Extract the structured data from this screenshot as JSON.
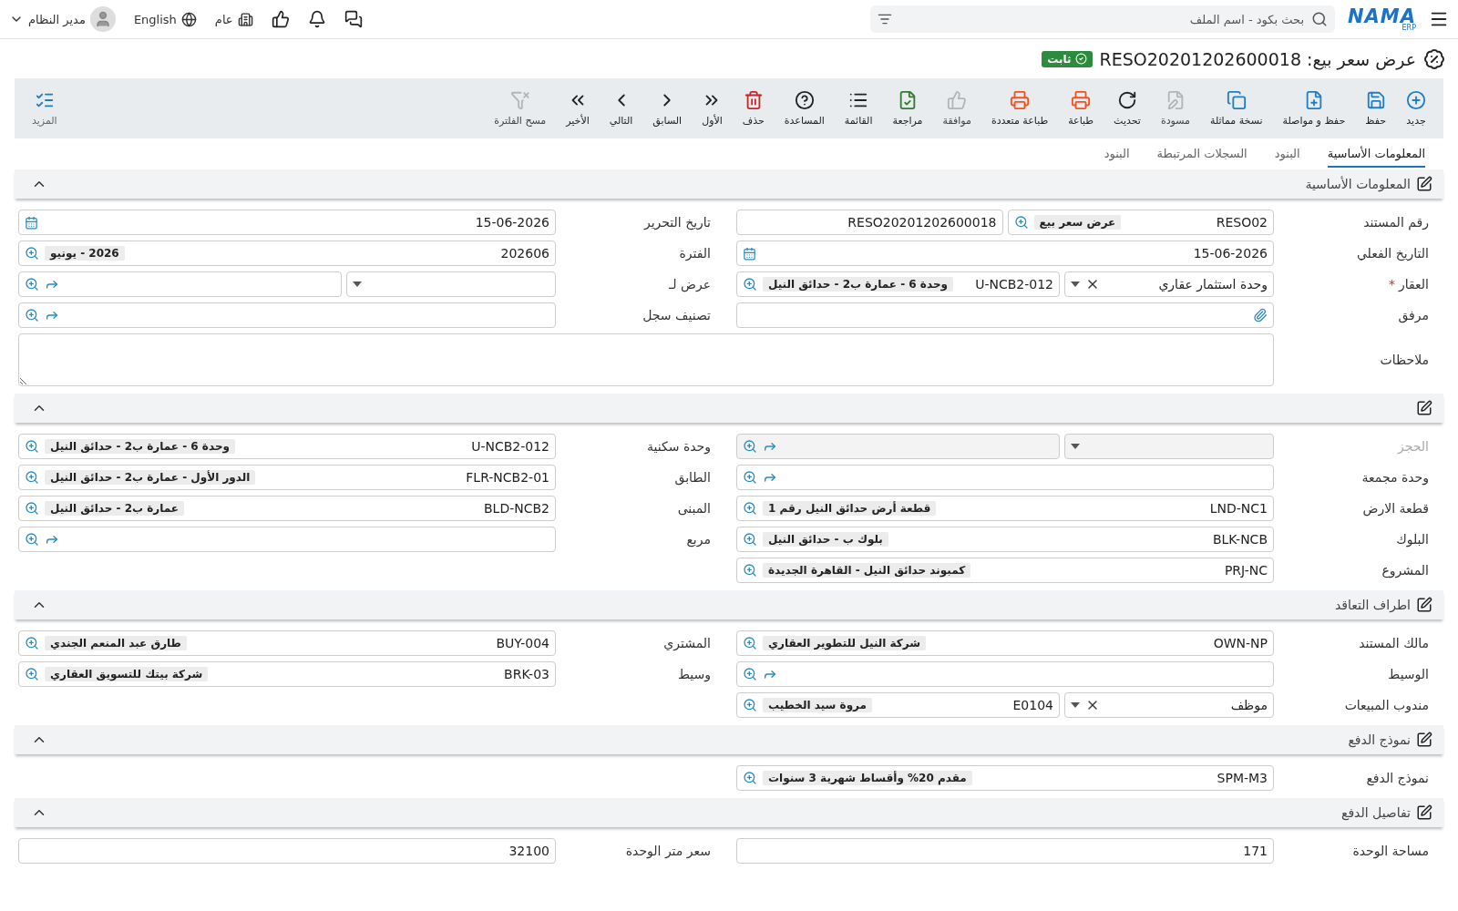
{
  "top_bar": {
    "logo": "NAMA",
    "logo_sub": "ERP",
    "search": {
      "placeholder": "بحث بكود - اسم الملف"
    },
    "user": "مدير النظام",
    "language": "English",
    "branch": "عام"
  },
  "title": {
    "text": "عرض سعر بيع: RESO20201202600018",
    "status": "ثابت"
  },
  "toolbar": {
    "buttons": [
      {
        "label": "جديد",
        "color": "#1f7fc4",
        "disabled": false
      },
      {
        "label": "حفظ",
        "color": "#1f7fc4",
        "disabled": false
      },
      {
        "label": "حفظ و مواصلة",
        "color": "#1f7fc4",
        "disabled": false
      },
      {
        "label": "نسخة مماثلة",
        "color": "#1f7fc4",
        "disabled": false
      },
      {
        "label": "مسودة",
        "color": "#b4b4b4",
        "disabled": true
      },
      {
        "label": "تحديث",
        "color": "#222222",
        "disabled": false
      },
      {
        "label": "طباعة",
        "color": "#f4511e",
        "disabled": false
      },
      {
        "label": "طباعة متعددة",
        "color": "#f4511e",
        "disabled": false
      },
      {
        "label": "موافقة",
        "color": "#b4b4b4",
        "disabled": true
      },
      {
        "label": "مراجعة",
        "color": "#2e7d32",
        "disabled": false
      },
      {
        "label": "القائمة",
        "color": "#222222",
        "disabled": false
      },
      {
        "label": "المساعدة",
        "color": "#222222",
        "disabled": false
      },
      {
        "label": "حذف",
        "color": "#c62828",
        "disabled": false
      },
      {
        "label": "الأول",
        "color": "#222222",
        "disabled": false
      },
      {
        "label": "السابق",
        "color": "#222222",
        "disabled": false
      },
      {
        "label": "التالي",
        "color": "#222222",
        "disabled": false
      },
      {
        "label": "الأخير",
        "color": "#222222",
        "disabled": false
      },
      {
        "label": "مسح الفلترة",
        "color": "#b4b4b4",
        "disabled": true
      }
    ],
    "more": {
      "label": "المزيد"
    }
  },
  "tabs": [
    {
      "label": "المعلومات الأساسية",
      "selected": true
    },
    {
      "label": "البنود",
      "selected": false
    },
    {
      "label": "السجلات المرتبطة",
      "selected": false
    },
    {
      "label": "البنود",
      "selected": false
    }
  ],
  "sections": [
    {
      "title": "المعلومات الأساسية",
      "expanded": true,
      "rows": [
        [
          {
            "label": "رقم المستند",
            "parts": [
              {
                "kind": "lookup",
                "value": "RESO02",
                "display": "عرض سعر بيع"
              },
              {
                "kind": "text",
                "value": "RESO20201202600018"
              }
            ]
          },
          {
            "label": "تاريخ التحرير",
            "parts": [
              {
                "kind": "date",
                "value": "15-06-2026"
              }
            ]
          }
        ],
        [
          {
            "label": "التاريخ الفعلي",
            "parts": [
              {
                "kind": "date",
                "value": "15-06-2026"
              }
            ]
          },
          {
            "label": "الفترة",
            "parts": [
              {
                "kind": "lookup",
                "value": "202606",
                "display": "2026 - يونيو"
              }
            ]
          }
        ],
        [
          {
            "label": "العقار",
            "required_mark": "*",
            "parts": [
              {
                "kind": "select",
                "value": "وحدة استثمار عقاري",
                "clearable": true
              },
              {
                "kind": "lookup",
                "value": "U-NCB2-012",
                "display": "وحدة 6 - عمارة ب2 - حدائق النيل"
              }
            ]
          },
          {
            "label": "عرض لـ",
            "parts": [
              {
                "kind": "select"
              },
              {
                "kind": "lookup",
                "link": true
              }
            ]
          }
        ],
        [
          {
            "label": "مرفق",
            "parts": [
              {
                "kind": "attach"
              }
            ]
          },
          {
            "label": "تصنيف سجل",
            "parts": [
              {
                "kind": "lookup",
                "link": true
              }
            ]
          }
        ],
        [
          {
            "label": "ملاحظات",
            "wide": true,
            "parts": [
              {
                "kind": "textarea"
              }
            ]
          }
        ]
      ]
    },
    {
      "expanded": true,
      "rows": [
        [
          {
            "label": "الحجز",
            "disabled": true,
            "parts": [
              {
                "kind": "select"
              },
              {
                "kind": "lookup",
                "link": true
              }
            ]
          },
          {
            "label": "وحدة سكنية",
            "parts": [
              {
                "kind": "lookup",
                "value": "U-NCB2-012",
                "display": "وحدة 6 - عمارة ب2 - حدائق النيل"
              }
            ]
          }
        ],
        [
          {
            "label": "وحدة مجمعة",
            "parts": [
              {
                "kind": "lookup",
                "link": true
              }
            ]
          },
          {
            "label": "الطابق",
            "parts": [
              {
                "kind": "lookup",
                "value": "FLR-NCB2-01",
                "display": "الدور الأول - عمارة ب2 - حدائق النيل"
              }
            ]
          }
        ],
        [
          {
            "label": "قطعة الارض",
            "parts": [
              {
                "kind": "lookup",
                "value": "LND-NC1",
                "display": "قطعة أرض حدائق النيل رقم 1"
              }
            ]
          },
          {
            "label": "المبنى",
            "parts": [
              {
                "kind": "lookup",
                "value": "BLD-NCB2",
                "display": "عمارة ب2 - حدائق النيل"
              }
            ]
          }
        ],
        [
          {
            "label": "البلوك",
            "parts": [
              {
                "kind": "lookup",
                "value": "BLK-NCB",
                "display": "بلوك ب - حدائق النيل"
              }
            ]
          },
          {
            "label": "مربع",
            "parts": [
              {
                "kind": "lookup",
                "link": true
              }
            ]
          }
        ],
        [
          {
            "label": "المشروع",
            "parts": [
              {
                "kind": "lookup",
                "value": "PRJ-NC",
                "display": "كمبوند حدائق النيل - القاهرة الجديدة"
              }
            ]
          }
        ]
      ]
    },
    {
      "title": "اطراف التعاقد",
      "expanded": true,
      "rows": [
        [
          {
            "label": "مالك المستند",
            "parts": [
              {
                "kind": "lookup",
                "value": "OWN-NP",
                "display": "شركة النيل للتطوير العقاري"
              }
            ]
          },
          {
            "label": "المشتري",
            "parts": [
              {
                "kind": "lookup",
                "value": "BUY-004",
                "display": "طارق عبد المنعم الجندي"
              }
            ]
          }
        ],
        [
          {
            "label": "الوسيط",
            "parts": [
              {
                "kind": "lookup",
                "link": true
              }
            ]
          },
          {
            "label": "وسيط",
            "parts": [
              {
                "kind": "lookup",
                "value": "BRK-03",
                "display": "شركة بيتك للتسويق العقاري"
              }
            ]
          }
        ],
        [
          {
            "label": "مندوب المبيعات",
            "parts": [
              {
                "kind": "select",
                "value": "موظف",
                "clearable": true
              },
              {
                "kind": "lookup",
                "value": "E0104",
                "display": "مروة سيد الخطيب"
              }
            ]
          }
        ]
      ]
    },
    {
      "title": "نموذج الدفع",
      "expanded": true,
      "rows": [
        [
          {
            "label": "نموذج الدفع",
            "parts": [
              {
                "kind": "lookup",
                "value": "SPM-M3",
                "display": "مقدم 20% وأقساط شهرية 3 سنوات"
              }
            ]
          }
        ]
      ]
    },
    {
      "title": "تفاصيل الدفع",
      "expanded": true,
      "rows": [
        [
          {
            "label": "مساحة الوحدة",
            "parts": [
              {
                "kind": "text",
                "value": "171"
              }
            ]
          },
          {
            "label": "سعر متر الوحدة",
            "parts": [
              {
                "kind": "text",
                "value": "32100"
              }
            ]
          }
        ]
      ]
    }
  ]
}
